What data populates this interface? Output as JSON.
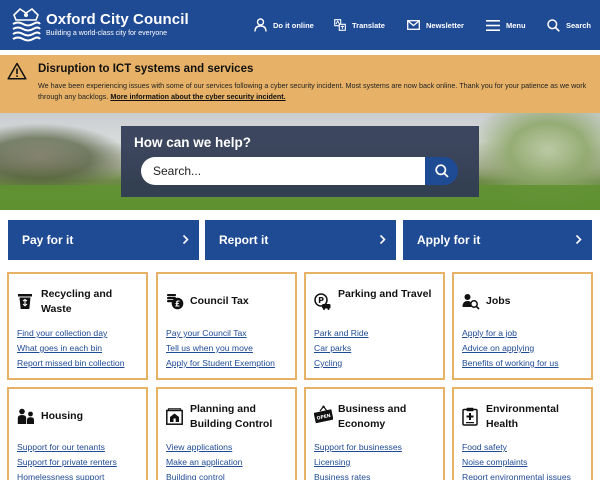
{
  "colors": {
    "brand_blue": "#1f4a94",
    "alert_amber": "#e7b267",
    "search_panel": "#2f3a54"
  },
  "header": {
    "title": "Oxford City Council",
    "tagline": "Building a world-class city for everyone",
    "logo_icon": "oxford-crest-icon",
    "nav": [
      {
        "label": "Do it online",
        "icon": "person-icon"
      },
      {
        "label": "Translate",
        "icon": "translate-icon"
      },
      {
        "label": "Newsletter",
        "icon": "envelope-icon"
      },
      {
        "label": "Menu",
        "icon": "hamburger-icon"
      },
      {
        "label": "Search",
        "icon": "search-icon"
      }
    ]
  },
  "alert": {
    "icon": "warning-icon",
    "title": "Disruption to ICT systems and services",
    "body": "We have been experiencing issues with some of our services following a cyber security incident. Most systems are now back online. Thank you for your patience as we work through any backlogs.",
    "link": "More information about the cyber security incident."
  },
  "hero": {
    "heading": "How can we help?",
    "search_placeholder": "Search...",
    "search_icon": "search-icon"
  },
  "quick_links": [
    {
      "label": "Pay for it"
    },
    {
      "label": "Report it"
    },
    {
      "label": "Apply for it"
    }
  ],
  "cards": [
    {
      "title": "Recycling and Waste",
      "icon": "recycling-bin-icon",
      "links": [
        "Find your collection day",
        "What goes in each bin",
        "Report missed bin collection"
      ]
    },
    {
      "title": "Council Tax",
      "icon": "coins-icon",
      "links": [
        "Pay your Council Tax",
        "Tell us when you move",
        "Apply for Student Exemption"
      ]
    },
    {
      "title": "Parking and Travel",
      "icon": "parking-icon",
      "links": [
        "Park and Ride",
        "Car parks",
        "Cycling"
      ]
    },
    {
      "title": "Jobs",
      "icon": "jobs-search-icon",
      "links": [
        "Apply for a job",
        "Advice on applying",
        "Benefits of working for us"
      ]
    },
    {
      "title": "Housing",
      "icon": "family-icon",
      "links": [
        "Support for our tenants",
        "Support for private renters",
        "Homelessness support"
      ]
    },
    {
      "title": "Planning and Building Control",
      "icon": "building-plan-icon",
      "links": [
        "View applications",
        "Make an application",
        "Building control"
      ]
    },
    {
      "title": "Business and Economy",
      "icon": "open-sign-icon",
      "links": [
        "Support for businesses",
        "Licensing",
        "Business rates"
      ]
    },
    {
      "title": "Environmental Health",
      "icon": "clipboard-health-icon",
      "links": [
        "Food safety",
        "Noise complaints",
        "Report environmental issues"
      ]
    }
  ]
}
